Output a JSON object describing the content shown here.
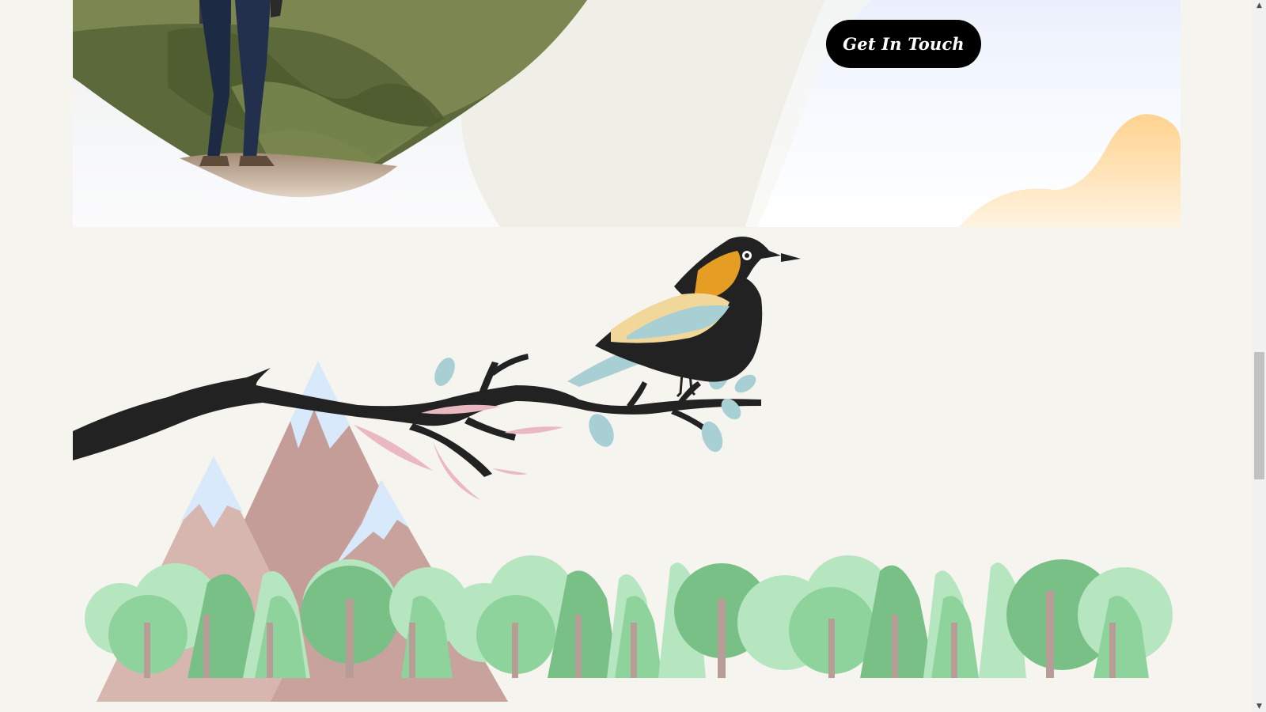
{
  "cta": {
    "label": "Get In Touch"
  },
  "scrollbar": {
    "up_icon": "▲",
    "down_icon": "▼"
  },
  "colors": {
    "background": "#f5f4ee",
    "button": "#000000",
    "button_text": "#ffffff",
    "branch": "#222222",
    "bird_orange": "#e69d24",
    "bird_blue": "#a8d0d4",
    "mountain": "#c49d98",
    "tree_light": "#b6e6c0",
    "tree_mid": "#8ed39b",
    "tree_dark": "#79c087",
    "trunk": "#b89c96",
    "sun_blob": "#ffd79a"
  }
}
